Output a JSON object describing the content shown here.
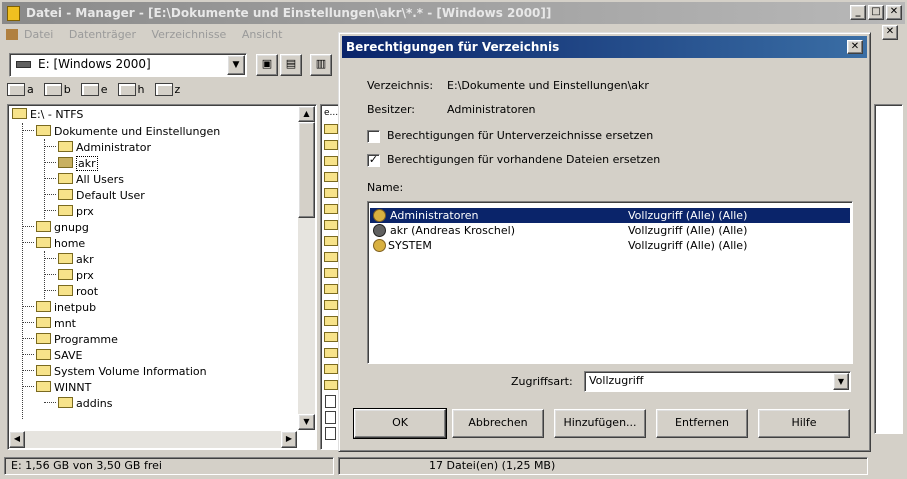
{
  "main_window": {
    "title": "Datei - Manager - [E:\\Dokumente und Einstellungen\\akr\\*.* - [Windows 2000]]",
    "menu": [
      "Datei",
      "Datenträger",
      "Verzeichnisse",
      "Ansicht"
    ],
    "window_buttons": [
      "_",
      "□",
      "✕"
    ]
  },
  "toolbar": {
    "drive_value": "E: [Windows 2000]"
  },
  "drive_tabs": [
    "a",
    "b",
    "e",
    "h",
    "z"
  ],
  "tree": {
    "items": [
      {
        "label": "E:\\ - NTFS",
        "level": 0
      },
      {
        "label": "Dokumente und Einstellungen",
        "level": 1
      },
      {
        "label": "Administrator",
        "level": 2
      },
      {
        "label": "akr",
        "level": 2
      },
      {
        "label": "All Users",
        "level": 2
      },
      {
        "label": "Default User",
        "level": 2
      },
      {
        "label": "prx",
        "level": 2
      },
      {
        "label": "gnupg",
        "level": 1
      },
      {
        "label": "home",
        "level": 1
      },
      {
        "label": "akr",
        "level": 2
      },
      {
        "label": "prx",
        "level": 2
      },
      {
        "label": "root",
        "level": 2
      },
      {
        "label": "inetpub",
        "level": 1
      },
      {
        "label": "mnt",
        "level": 1
      },
      {
        "label": "Programme",
        "level": 1
      },
      {
        "label": "SAVE",
        "level": 1
      },
      {
        "label": "System Volume Information",
        "level": 1
      },
      {
        "label": "WINNT",
        "level": 1
      },
      {
        "label": "addins",
        "level": 2
      }
    ],
    "selected_index": 3
  },
  "files": {
    "first_row_label": "e..."
  },
  "status": {
    "free_space": "E: 1,56 GB von 3,50 GB frei",
    "file_count": "17 Datei(en) (1,25 MB)"
  },
  "dialog": {
    "title": "Berechtigungen für Verzeichnis",
    "close": "✕",
    "directory_label": "Verzeichnis:",
    "directory_value": "E:\\Dokumente und Einstellungen\\akr",
    "owner_label": "Besitzer:",
    "owner_value": "Administratoren",
    "checkbox_subdirs": "Berechtigungen für Unterverzeichnisse ersetzen",
    "checkbox_subdirs_checked": false,
    "checkbox_files": "Berechtigungen für vorhandene Dateien ersetzen",
    "checkbox_files_checked": true,
    "name_label": "Name:",
    "permissions": [
      {
        "name": "Administratoren",
        "access": "Vollzugriff (Alle) (Alle)",
        "selected": true
      },
      {
        "name": "akr (Andreas Kroschel)",
        "access": "Vollzugriff (Alle) (Alle)",
        "selected": false
      },
      {
        "name": "SYSTEM",
        "access": "Vollzugriff (Alle) (Alle)",
        "selected": false
      }
    ],
    "access_type_label": "Zugriffsart:",
    "access_type_value": "Vollzugriff",
    "buttons": {
      "ok": "OK",
      "cancel": "Abbrechen",
      "add": "Hinzufügen...",
      "remove": "Entfernen",
      "help": "Hilfe"
    }
  }
}
